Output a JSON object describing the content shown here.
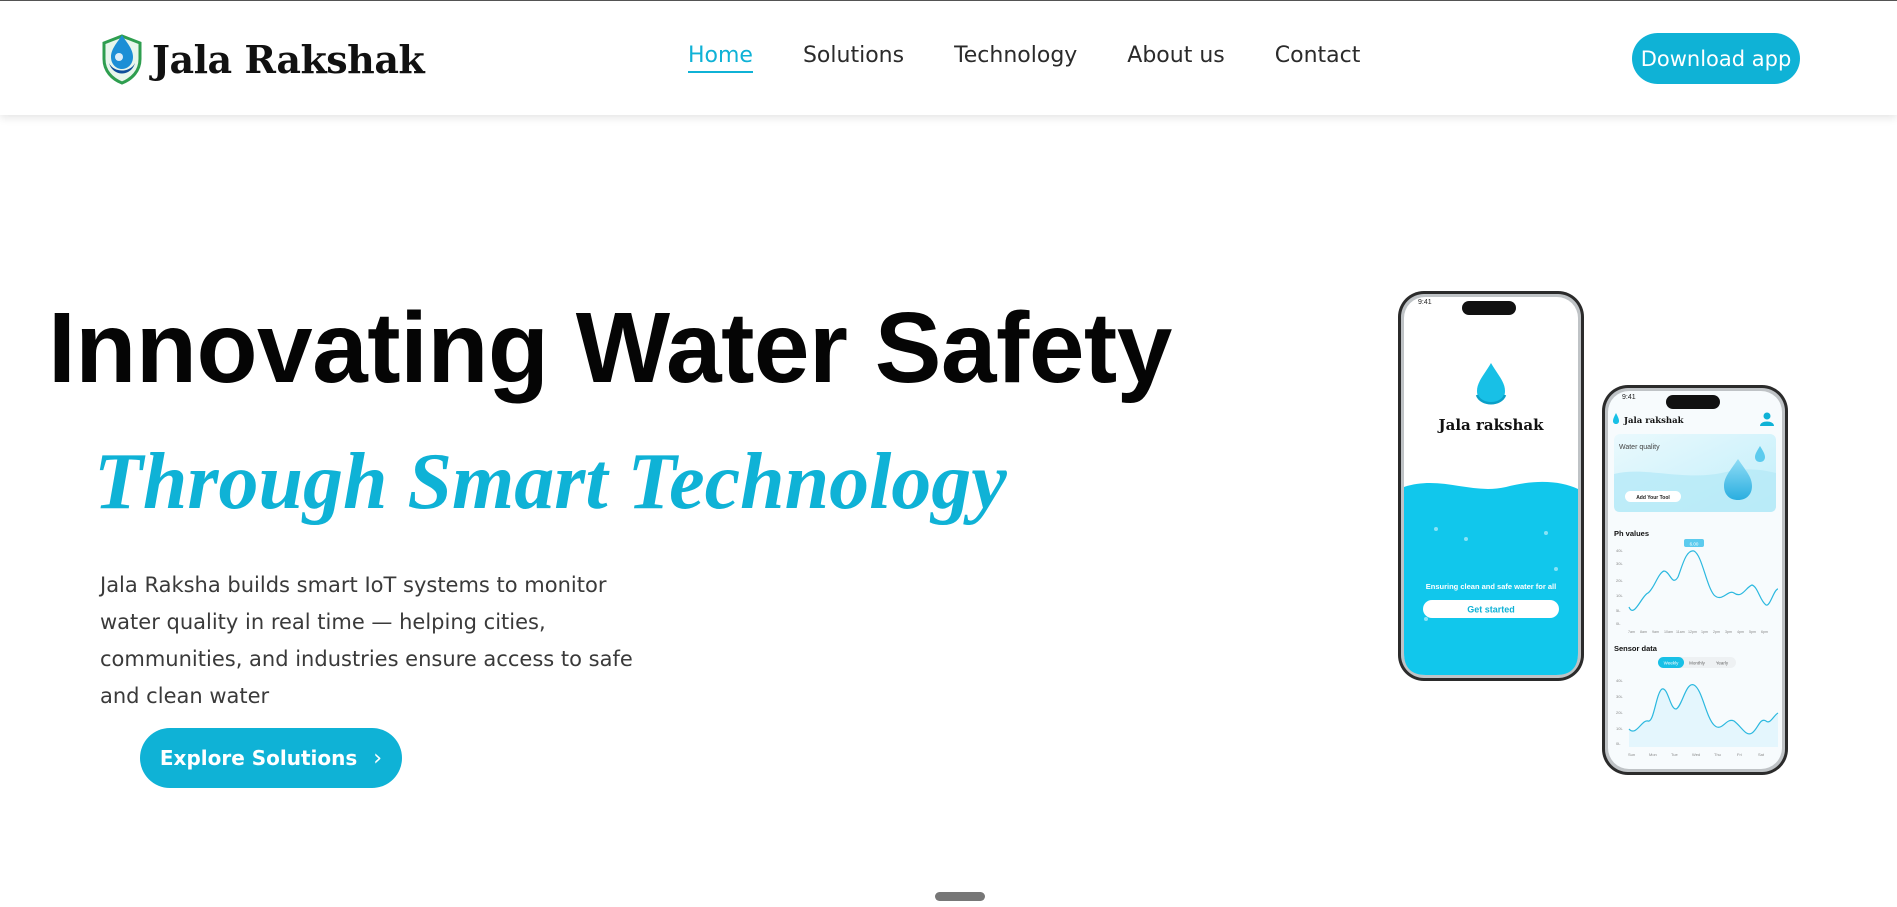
{
  "brand": {
    "name": "Jala Rakshak",
    "accent": "#0fb2d6"
  },
  "nav": {
    "links": [
      {
        "label": "Home",
        "active": true
      },
      {
        "label": "Solutions",
        "active": false
      },
      {
        "label": "Technology",
        "active": false
      },
      {
        "label": "About us",
        "active": false
      },
      {
        "label": "Contact",
        "active": false
      }
    ],
    "cta_label": "Download app"
  },
  "hero": {
    "title": "Innovating Water Safety",
    "subtitle": "Through Smart Technology",
    "description": "Jala Raksha builds smart IoT systems to monitor water quality in real time — helping cities, communities, and industries ensure access to safe and clean water",
    "cta_label": "Explore Solutions",
    "cta_icon": "chevron-right-icon"
  },
  "phone_left": {
    "time": "9:41",
    "app_name": "Jala rakshak",
    "tagline": "Ensuring clean and safe water for all",
    "button_label": "Get started"
  },
  "phone_right": {
    "time": "9:41",
    "app_name": "Jala rakshak",
    "card_title": "Water quality",
    "card_button": "Add Your Tool",
    "ph_title": "Ph values",
    "ph_badge": "6.00",
    "ph_y_labels": [
      "40L",
      "30L",
      "20L",
      "10L",
      "5L",
      "0L"
    ],
    "ph_x_labels": [
      "7am",
      "8am",
      "9am",
      "10am",
      "11am",
      "12pm",
      "1pm",
      "2pm",
      "3pm",
      "4pm",
      "5pm",
      "6pm"
    ],
    "sensor_title": "Sensor data",
    "sensor_tabs": [
      "Weekly",
      "Monthly",
      "Yearly"
    ],
    "sensor_y_labels": [
      "40L",
      "30L",
      "20L",
      "10L",
      "0L"
    ],
    "sensor_x_labels": [
      "Sun",
      "Mon",
      "Tue",
      "Wed",
      "Thu",
      "Fri",
      "Sat"
    ]
  }
}
